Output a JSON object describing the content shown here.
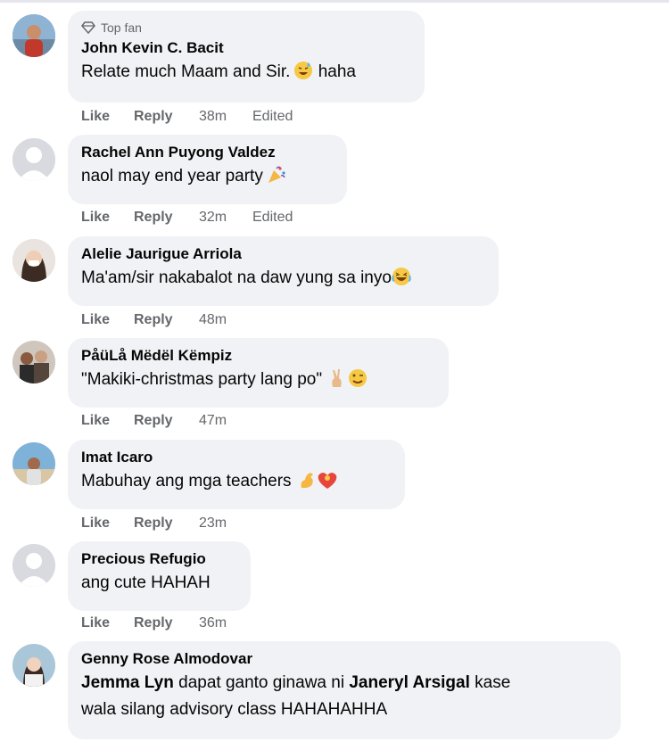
{
  "comments": [
    {
      "author": "John Kevin C. Bacit",
      "badge": "Top fan",
      "text": "Relate much Maam and Sir.",
      "text_after": " haha",
      "emoji": "sweat-smile",
      "like": "Like",
      "reply": "Reply",
      "time": "38m",
      "edited": "Edited",
      "avatar": "photo"
    },
    {
      "author": "Rachel Ann Puyong Valdez",
      "text": "naol may end year party",
      "emoji": "party-popper",
      "like": "Like",
      "reply": "Reply",
      "time": "32m",
      "edited": "Edited",
      "avatar": "default"
    },
    {
      "author": "Alelie Jaurigue Arriola",
      "text": "Ma'am/sir nakabalot na daw yung sa inyo",
      "emoji": "laughing-crying",
      "like": "Like",
      "reply": "Reply",
      "time": "48m",
      "avatar": "photo"
    },
    {
      "author": "PåüLå Mëdël Këmpiz",
      "text": "\"Makiki-christmas party lang po\"",
      "emoji": "victory-wink",
      "like": "Like",
      "reply": "Reply",
      "time": "47m",
      "avatar": "photo"
    },
    {
      "author": "Imat Icaro",
      "text": "Mabuhay ang mga teachers",
      "emoji": "muscle-heart",
      "like": "Like",
      "reply": "Reply",
      "time": "23m",
      "avatar": "photo"
    },
    {
      "author": "Precious Refugio",
      "text": "ang cute HAHAH",
      "like": "Like",
      "reply": "Reply",
      "time": "36m",
      "avatar": "default"
    },
    {
      "author": "Genny Rose Almodovar",
      "mention1": "Jemma Lyn",
      "text_mid": " dapat ganto ginawa ni ",
      "mention2": "Janeryl Arsigal",
      "text_end": " kase",
      "text_line2": "wala silang advisory class HAHAHAHHA",
      "avatar": "photo"
    }
  ]
}
